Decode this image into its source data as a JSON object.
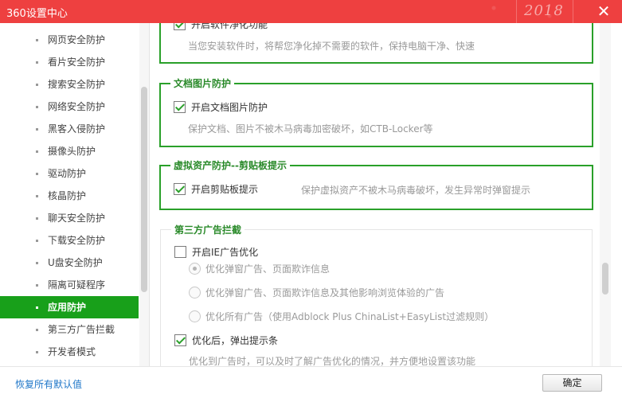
{
  "window": {
    "title": "360设置中心",
    "year_badge": "2018"
  },
  "sidebar": {
    "items": [
      {
        "label": "网页安全防护",
        "active": false
      },
      {
        "label": "看片安全防护",
        "active": false
      },
      {
        "label": "搜索安全防护",
        "active": false
      },
      {
        "label": "网络安全防护",
        "active": false
      },
      {
        "label": "黑客入侵防护",
        "active": false
      },
      {
        "label": "摄像头防护",
        "active": false
      },
      {
        "label": "驱动防护",
        "active": false
      },
      {
        "label": "核晶防护",
        "active": false
      },
      {
        "label": "聊天安全防护",
        "active": false
      },
      {
        "label": "下载安全防护",
        "active": false
      },
      {
        "label": "U盘安全防护",
        "active": false
      },
      {
        "label": "隔离可疑程序",
        "active": false
      },
      {
        "label": "应用防护",
        "active": true
      },
      {
        "label": "第三方广告拦截",
        "active": false
      },
      {
        "label": "开发者模式",
        "active": false
      }
    ]
  },
  "sections": {
    "software_purify": {
      "checkbox_label": "开启软件净化功能",
      "checked": true,
      "desc": "当您安装软件时，将帮您净化掉不需要的软件，保持电脑干净、快速"
    },
    "doc_image": {
      "title": "文档图片防护",
      "checkbox_label": "开启文档图片防护",
      "checked": true,
      "desc": "保护文档、图片不被木马病毒加密破坏，如CTB-Locker等"
    },
    "virtual_asset": {
      "title": "虚拟资产防护--剪贴板提示",
      "checkbox_label": "开启剪贴板提示",
      "checked": true,
      "desc": "保护虚拟资产不被木马病毒破坏，发生异常时弹窗提示"
    },
    "third_party_ads": {
      "title": "第三方广告拦截",
      "ie_checkbox_label": "开启IE广告优化",
      "ie_checked": false,
      "radio_options": [
        {
          "label": "优化弹窗广告、页面欺诈信息",
          "selected": true
        },
        {
          "label": "优化弹窗广告、页面欺诈信息及其他影响浏览体验的广告",
          "selected": false
        },
        {
          "label": "优化所有广告（使用Adblock Plus ChinaList+EasyList过滤规则）",
          "selected": false
        }
      ],
      "popup_checkbox_label": "优化后，弹出提示条",
      "popup_checked": true,
      "popup_desc": "优化到广告时，可以及时了解广告优化的情况，并方便地设置该功能"
    }
  },
  "footer": {
    "restore_label": "恢复所有默认值",
    "ok_label": "确定"
  },
  "colors": {
    "titlebar": "#ee4040",
    "accent_green": "#18a01a",
    "link_blue": "#1e76c8"
  }
}
